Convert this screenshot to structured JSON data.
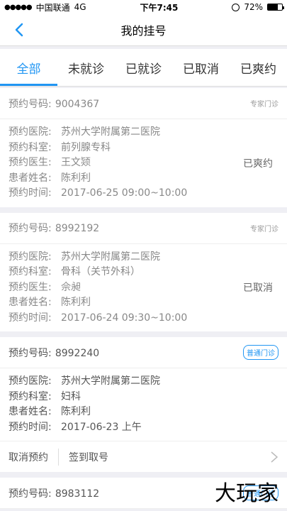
{
  "status": {
    "carrier": "中国联通",
    "network": "4G",
    "time": "下午7:45",
    "battery": "72%",
    "battery_level": 0.72
  },
  "nav": {
    "title": "我的挂号"
  },
  "tabs": [
    "全部",
    "未就诊",
    "已就诊",
    "已取消",
    "已爽约"
  ],
  "labels": {
    "number": "预约号码:",
    "hospital": "预约医院:",
    "department": "预约科室:",
    "doctor": "预约医生:",
    "patient": "患者姓名:",
    "time": "预约时间:"
  },
  "appointments": [
    {
      "number": "9004367",
      "badge": "专家门诊",
      "hospital": "苏州大学附属第二医院",
      "department": "前列腺专科",
      "doctor": "王文颎",
      "patient": "陈利利",
      "time": "2017-06-25 09:00~10:00",
      "status": "已爽约"
    },
    {
      "number": "8992192",
      "badge": "专家门诊",
      "hospital": "苏州大学附属第二医院",
      "department": "骨科（关节外科）",
      "doctor": "佘昶",
      "patient": "陈利利",
      "time": "2017-06-24 09:30~10:00",
      "status": "已取消"
    },
    {
      "number": "8992240",
      "badge": "普通门诊",
      "hospital": "苏州大学附属第二医院",
      "department": "妇科",
      "patient": "陈利利",
      "time": "2017-06-23 上午",
      "actions": [
        "取消预约",
        "签到取号"
      ]
    },
    {
      "number": "8983112",
      "badge": "普通门诊"
    }
  ],
  "watermark": "大玩家"
}
